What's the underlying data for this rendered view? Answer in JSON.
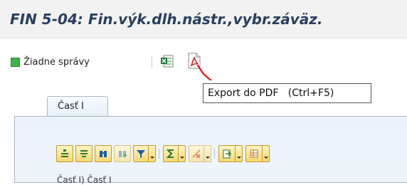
{
  "window": {
    "title": "FIN 5-04: Fin.výk.dlh.nástr.,vybr.záväz."
  },
  "toolbar": {
    "message_label": "Žiadne správy",
    "message_status_color": "#39b54a",
    "excel_icon": "excel-export-icon",
    "pdf_icon": "pdf-export-icon"
  },
  "tooltip": {
    "text": "Export do PDF   (Ctrl+F5)"
  },
  "tabs": [
    {
      "label": "Časť I"
    }
  ],
  "table_toolbar": {
    "buttons": [
      {
        "icon": "align-icon"
      },
      {
        "icon": "filter-list-icon"
      },
      {
        "icon": "find-icon"
      },
      {
        "icon": "find-next-icon",
        "disabled": true
      },
      {
        "icon": "filter-icon",
        "dropdown": true
      },
      {
        "icon": "sum-icon",
        "dropdown": true
      },
      {
        "icon": "subtotal-icon",
        "dropdown": true,
        "disabled": true
      },
      {
        "icon": "export-icon",
        "dropdown": true
      },
      {
        "icon": "layout-icon",
        "dropdown": true
      }
    ]
  },
  "breadcrumb": {
    "text": "Časť I) Časť I"
  },
  "colors": {
    "title": "#2a3f5f",
    "pointer": "#e02020",
    "panel": "#eaf2fb"
  }
}
